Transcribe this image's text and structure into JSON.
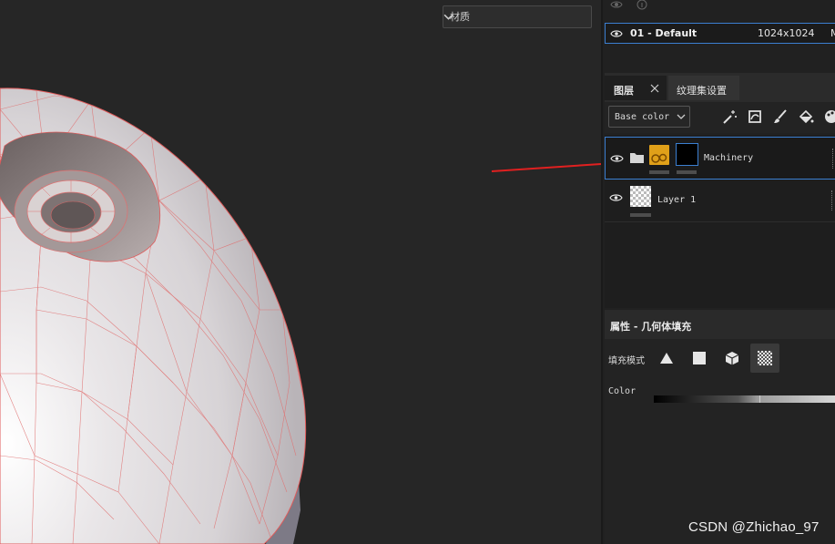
{
  "viewport": {
    "material_select": "材质"
  },
  "texture_set_list": {
    "top_icons": [
      "eye-add-icon",
      "info-icon"
    ],
    "row": {
      "name": "01 - Default",
      "resolution": "1024x1024",
      "extra": "M"
    }
  },
  "layers_panel": {
    "tabs": [
      {
        "label": "图层",
        "closable": true
      },
      {
        "label": "纹理集设置"
      }
    ],
    "channel_select": "Base color",
    "toolbar_icons": [
      "magic-wand-icon",
      "smart-mask-icon",
      "brush-icon",
      "fill-bucket-icon",
      "palette-icon"
    ],
    "layers": [
      {
        "name": "Machinery",
        "type": "folder",
        "selected": true
      },
      {
        "name": "Layer 1",
        "type": "fill"
      }
    ]
  },
  "properties": {
    "title": "属性 - 几何体填充",
    "fill_mode_label": "填充模式",
    "fill_modes": [
      "triangle-icon",
      "square-icon",
      "cube-icon",
      "checker-icon"
    ],
    "active_fill_mode": "checker-icon",
    "color_label": "Color"
  },
  "watermark": "CSDN @Zhichao_97",
  "colors": {
    "accent": "#3b7fd1",
    "wireframe": "#e05a5a",
    "arrow": "#e02020"
  }
}
